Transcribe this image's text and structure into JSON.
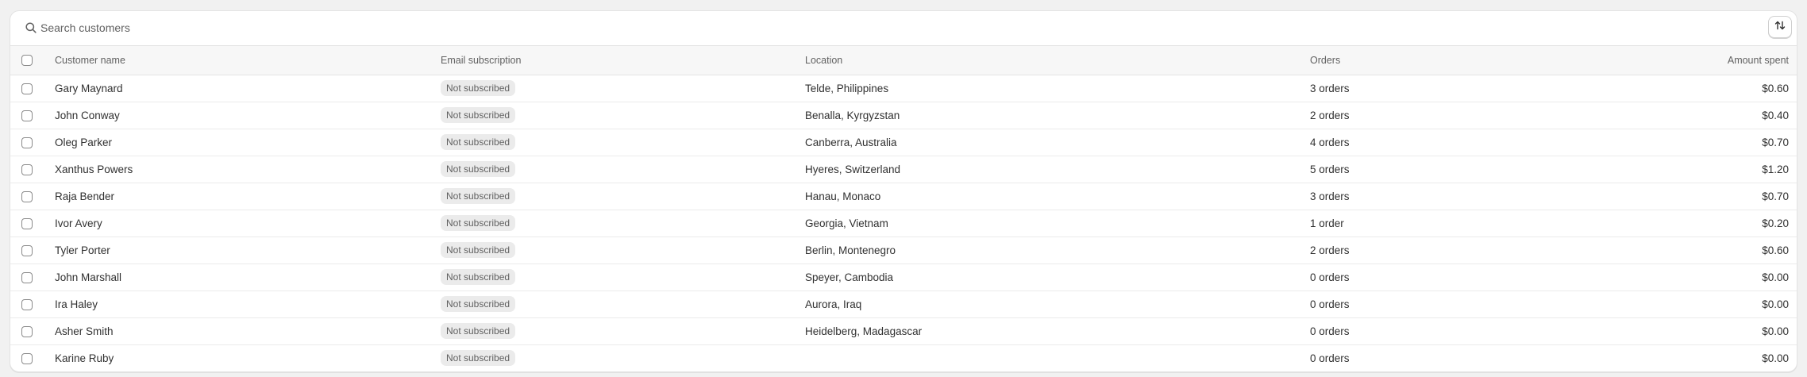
{
  "search": {
    "placeholder": "Search customers"
  },
  "icons": {
    "search": "search-icon",
    "sort": "sort-arrows-icon"
  },
  "table": {
    "headers": {
      "name": "Customer name",
      "email": "Email subscription",
      "location": "Location",
      "orders": "Orders",
      "amount": "Amount spent"
    },
    "rows": [
      {
        "name": "Gary Maynard",
        "email": "Not subscribed",
        "location": "Telde, Philippines",
        "orders": "3 orders",
        "amount": "$0.60"
      },
      {
        "name": "John Conway",
        "email": "Not subscribed",
        "location": "Benalla, Kyrgyzstan",
        "orders": "2 orders",
        "amount": "$0.40"
      },
      {
        "name": "Oleg Parker",
        "email": "Not subscribed",
        "location": "Canberra, Australia",
        "orders": "4 orders",
        "amount": "$0.70"
      },
      {
        "name": "Xanthus Powers",
        "email": "Not subscribed",
        "location": "Hyeres, Switzerland",
        "orders": "5 orders",
        "amount": "$1.20"
      },
      {
        "name": "Raja Bender",
        "email": "Not subscribed",
        "location": "Hanau, Monaco",
        "orders": "3 orders",
        "amount": "$0.70"
      },
      {
        "name": "Ivor Avery",
        "email": "Not subscribed",
        "location": "Georgia, Vietnam",
        "orders": "1 order",
        "amount": "$0.20"
      },
      {
        "name": "Tyler Porter",
        "email": "Not subscribed",
        "location": "Berlin, Montenegro",
        "orders": "2 orders",
        "amount": "$0.60"
      },
      {
        "name": "John Marshall",
        "email": "Not subscribed",
        "location": "Speyer, Cambodia",
        "orders": "0 orders",
        "amount": "$0.00"
      },
      {
        "name": "Ira Haley",
        "email": "Not subscribed",
        "location": "Aurora, Iraq",
        "orders": "0 orders",
        "amount": "$0.00"
      },
      {
        "name": "Asher Smith",
        "email": "Not subscribed",
        "location": "Heidelberg, Madagascar",
        "orders": "0 orders",
        "amount": "$0.00"
      },
      {
        "name": "Karine Ruby",
        "email": "Not subscribed",
        "location": "",
        "orders": "0 orders",
        "amount": "$0.00"
      }
    ]
  }
}
